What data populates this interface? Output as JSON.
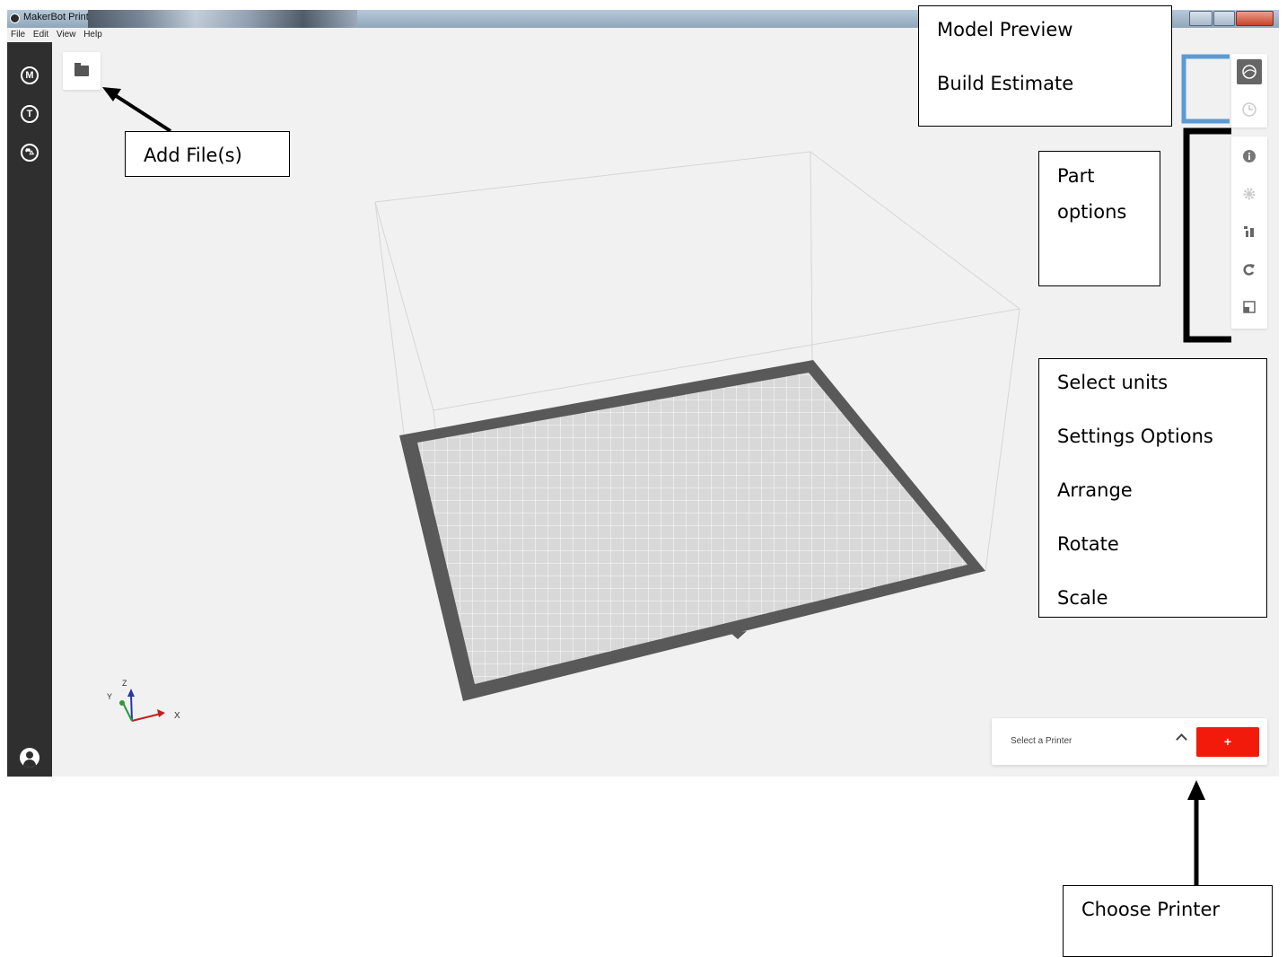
{
  "window": {
    "title": "MakerBot Print"
  },
  "menu": [
    "File",
    "Edit",
    "View",
    "Help"
  ],
  "sidebar": {
    "icons": [
      {
        "name": "makerbot-logo-icon",
        "glyph": "M"
      },
      {
        "name": "thingiverse-icon",
        "glyph": "T"
      },
      {
        "name": "store-cart-icon",
        "glyph": "⛍"
      }
    ],
    "profile_icon": "user-profile-icon"
  },
  "toolbar": {
    "add_file_icon": "folder-icon"
  },
  "right_toolbar": {
    "view_modes": [
      "model-preview-icon",
      "build-estimate-icon"
    ],
    "part_tools": [
      "info-icon",
      "settings-gear-icon",
      "arrange-icon",
      "rotate-icon",
      "scale-icon"
    ]
  },
  "axes": {
    "x": "X",
    "y": "Y",
    "z": "Z"
  },
  "printer_bar": {
    "label": "Select a Printer",
    "add_label": "+"
  },
  "annotations": {
    "add_files": "Add File(s)",
    "view_modes": [
      "Model Preview",
      "Build Estimate"
    ],
    "part_options": [
      "Part",
      "options"
    ],
    "tools": [
      "Select units",
      "Settings Options",
      "Arrange",
      "Rotate",
      "Scale"
    ],
    "choose_printer": "Choose Printer"
  },
  "colors": {
    "sidebar": "#2f2f2f",
    "accent_red": "#f21b0b",
    "bracket_blue": "#5b9bd5"
  }
}
